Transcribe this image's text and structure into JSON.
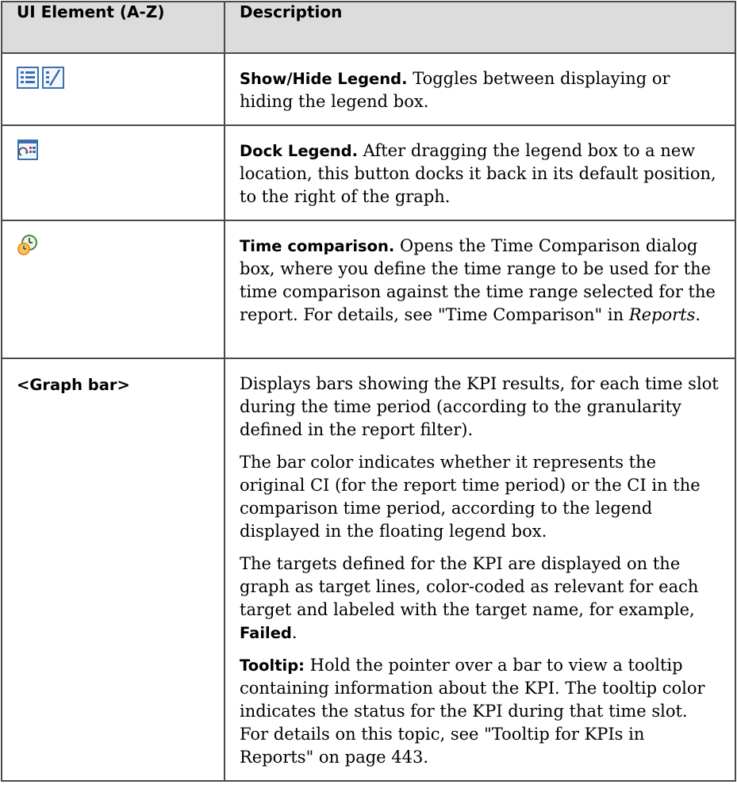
{
  "table": {
    "headers": [
      "UI Element (A-Z)",
      "Description"
    ],
    "rows": [
      {
        "element_icons": [
          "legend-show-icon",
          "legend-hide-icon"
        ],
        "title": "Show/Hide Legend.",
        "text": "Toggles between displaying or hiding the legend box."
      },
      {
        "element_icons": [
          "dock-legend-icon"
        ],
        "title": "Dock Legend.",
        "text": "After dragging the legend box to a new location, this button docks it back in its default position, to the right of the graph."
      },
      {
        "element_icons": [
          "time-comparison-icon"
        ],
        "title": "Time comparison.",
        "text": "Opens the Time Comparison dialog box, where you define the time range to be used for the time comparison against the time range selected for the report. For details, see \"Time Comparison\" in",
        "ref": "Reports",
        "after_ref": "."
      },
      {
        "element_label": "<Graph bar>",
        "p1": "Displays bars showing the KPI results, for each time slot during the time period (according to the granularity defined in the report filter).",
        "p2": "The bar color indicates whether it represents the original CI (for the report time period) or the CI in the comparison time period, according to the legend displayed in the floating legend box.",
        "p3": "The targets defined for the KPI are displayed on the graph as target lines, color-coded as relevant for each target and labeled with the target name, for example,",
        "p3_example": "Failed",
        "p3_end": ".",
        "p4_label": "Tooltip:",
        "p4": "Hold the pointer over a bar to view a tooltip containing information about the KPI. The tooltip color indicates the status for the KPI during that time slot. For details on this topic, see \"Tooltip for KPIs in Reports\" on page 443."
      }
    ]
  },
  "colors": {
    "header_bg": "#dcdcdc",
    "border": "#4a4a4a",
    "icon_blue": "#3a6fb0",
    "icon_orange": "#e8901a"
  }
}
